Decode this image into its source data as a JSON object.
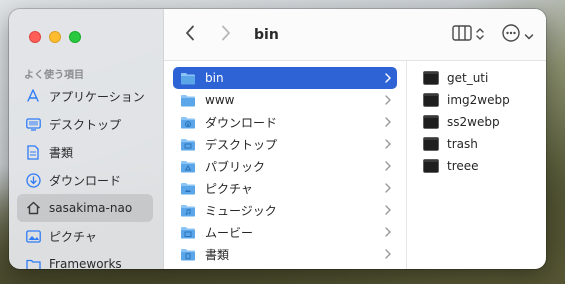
{
  "window": {
    "title": "bin"
  },
  "sidebar": {
    "section_label": "よく使う項目",
    "items": [
      {
        "label": "アプリケーション",
        "icon": "applications-icon"
      },
      {
        "label": "デスクトップ",
        "icon": "desktop-icon"
      },
      {
        "label": "書類",
        "icon": "document-icon"
      },
      {
        "label": "ダウンロード",
        "icon": "download-icon"
      },
      {
        "label": "sasakima-nao",
        "icon": "home-icon",
        "selected": true
      },
      {
        "label": "ピクチャ",
        "icon": "pictures-icon"
      },
      {
        "label": "Frameworks",
        "icon": "folder-icon"
      }
    ]
  },
  "toolbar": {
    "back_icon": "chevron-left-icon",
    "forward_icon": "chevron-right-icon",
    "view_icon": "column-view-icon",
    "more_icon": "ellipsis-circle-icon"
  },
  "column1": {
    "items": [
      {
        "label": "bin",
        "icon": "folder-icon",
        "selected": true
      },
      {
        "label": "www",
        "icon": "folder-icon"
      },
      {
        "label": "ダウンロード",
        "icon": "download-folder-icon"
      },
      {
        "label": "デスクトップ",
        "icon": "desktop-folder-icon"
      },
      {
        "label": "パブリック",
        "icon": "public-folder-icon"
      },
      {
        "label": "ピクチャ",
        "icon": "pictures-folder-icon"
      },
      {
        "label": "ミュージック",
        "icon": "music-folder-icon"
      },
      {
        "label": "ムービー",
        "icon": "movies-folder-icon"
      },
      {
        "label": "書類",
        "icon": "documents-folder-icon"
      }
    ]
  },
  "column2": {
    "items": [
      {
        "label": "get_uti",
        "icon": "exec-icon"
      },
      {
        "label": "img2webp",
        "icon": "exec-icon"
      },
      {
        "label": "ss2webp",
        "icon": "exec-icon"
      },
      {
        "label": "trash",
        "icon": "exec-icon"
      },
      {
        "label": "treee",
        "icon": "exec-icon"
      }
    ]
  },
  "colors": {
    "accent": "#2e63d6",
    "folder": "#5aa6e8",
    "sidebar_icon": "#2f7bf6"
  }
}
